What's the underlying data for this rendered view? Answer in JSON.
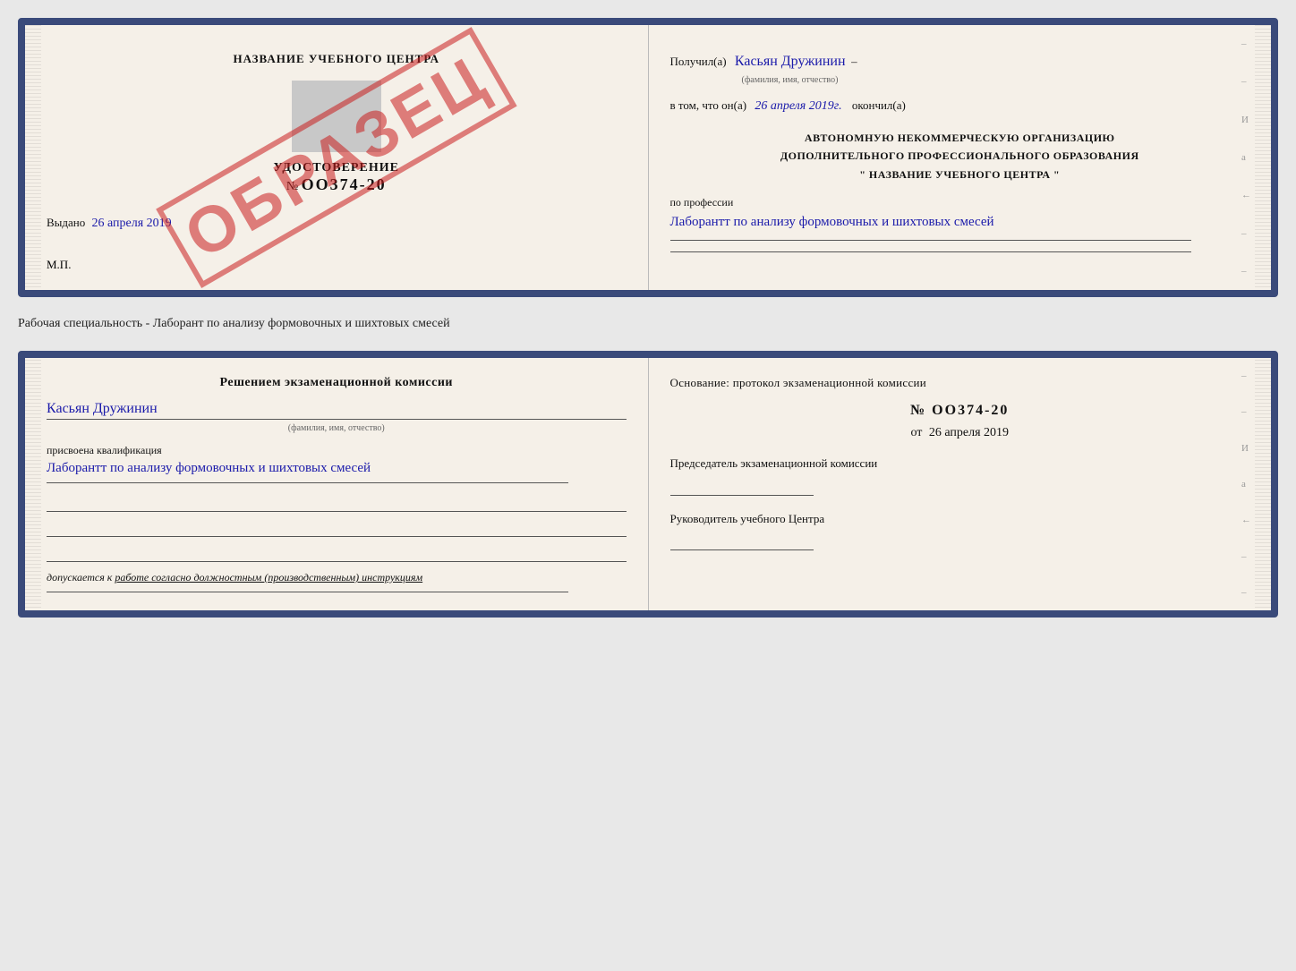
{
  "page": {
    "background": "#e8e8e8"
  },
  "separator": {
    "text": "Рабочая специальность - Лаборант по анализу формовочных и шихтовых смесей"
  },
  "cert_doc": {
    "left": {
      "title": "НАЗВАНИЕ УЧЕБНОГО ЦЕНТРА",
      "cert_label": "УДОСТОВЕРЕНИЕ",
      "cert_number_prefix": "№",
      "cert_number": "OO374-20",
      "issued_label": "Выдано",
      "issued_date": "26 апреля 2019",
      "mp_label": "М.П.",
      "obrazec": "ОБРАЗЕЦ"
    },
    "right": {
      "received_label": "Получил(а)",
      "received_name": "Касьян Дружинин",
      "fio_sublabel": "(фамилия, имя, отчество)",
      "inthat_prefix": "в том, что он(а)",
      "inthat_date": "26 апреля 2019г.",
      "finished_label": "окончил(а)",
      "org_line1": "АВТОНОМНУЮ НЕКОММЕРЧЕСКУЮ ОРГАНИЗАЦИЮ",
      "org_line2": "ДОПОЛНИТЕЛЬНОГО ПРОФЕССИОНАЛЬНОГО ОБРАЗОВАНИЯ",
      "org_line3": "\"    НАЗВАНИЕ УЧЕБНОГО ЦЕНТРА    \"",
      "profession_label": "по профессии",
      "profession_handwritten": "Лаборантт по анализу формовочных и шихтовых смесей"
    }
  },
  "qual_doc": {
    "left": {
      "section_title": "Решением экзаменационной комиссии",
      "name_handwritten": "Касьян Дружинин",
      "fio_sublabel": "(фамилия, имя, отчество)",
      "qualification_label": "присвоена квалификация",
      "qualification_handwritten": "Лаборантт по анализу формовочных и шихтовых смесей",
      "admit_label": "допускается к",
      "admit_text": "работе согласно должностным (производственным) инструкциям"
    },
    "right": {
      "basis_title": "Основание: протокол экзаменационной комиссии",
      "protocol_number": "№ OO374-20",
      "protocol_date_prefix": "от",
      "protocol_date": "26 апреля 2019",
      "chairman_title": "Председатель экзаменационной комиссии",
      "director_title": "Руководитель учебного Центра"
    }
  },
  "edge_marks": {
    "top_dash": "–",
    "marks": [
      "–",
      "–",
      "И",
      "а",
      "←",
      "–",
      "–",
      "–"
    ]
  }
}
